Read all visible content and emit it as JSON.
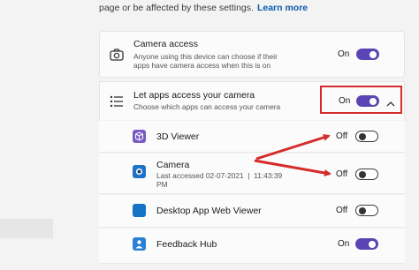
{
  "intro": {
    "text": "page or be affected by these settings.",
    "link": "Learn more"
  },
  "camera_access": {
    "title": "Camera access",
    "desc_line1": "Anyone using this device can choose if their",
    "desc_line2": "apps have camera access when this is on",
    "state": "On",
    "on": true,
    "icon": "camera-icon"
  },
  "let_apps": {
    "title": "Let apps access your camera",
    "desc": "Choose which apps can access your camera",
    "state": "On",
    "on": true,
    "icon": "list-icon",
    "expander": "chevron-up-icon"
  },
  "apps": [
    {
      "name": "3D Viewer",
      "state": "Off",
      "on": false,
      "color": "#7a5bc4"
    },
    {
      "name": "Camera",
      "last_line1": "Last accessed 02-07-2021  |  11:43:39",
      "last_line2": "PM",
      "state": "Off",
      "on": false,
      "color": "#1f73c7"
    },
    {
      "name": "Desktop App Web Viewer",
      "state": "Off",
      "on": false,
      "color": "#1572c4"
    },
    {
      "name": "Feedback Hub",
      "state": "On",
      "on": true,
      "color": "#2b7fd4"
    }
  ],
  "colors": {
    "accent": "#5b45b5",
    "annotation": "#d52b2b"
  }
}
